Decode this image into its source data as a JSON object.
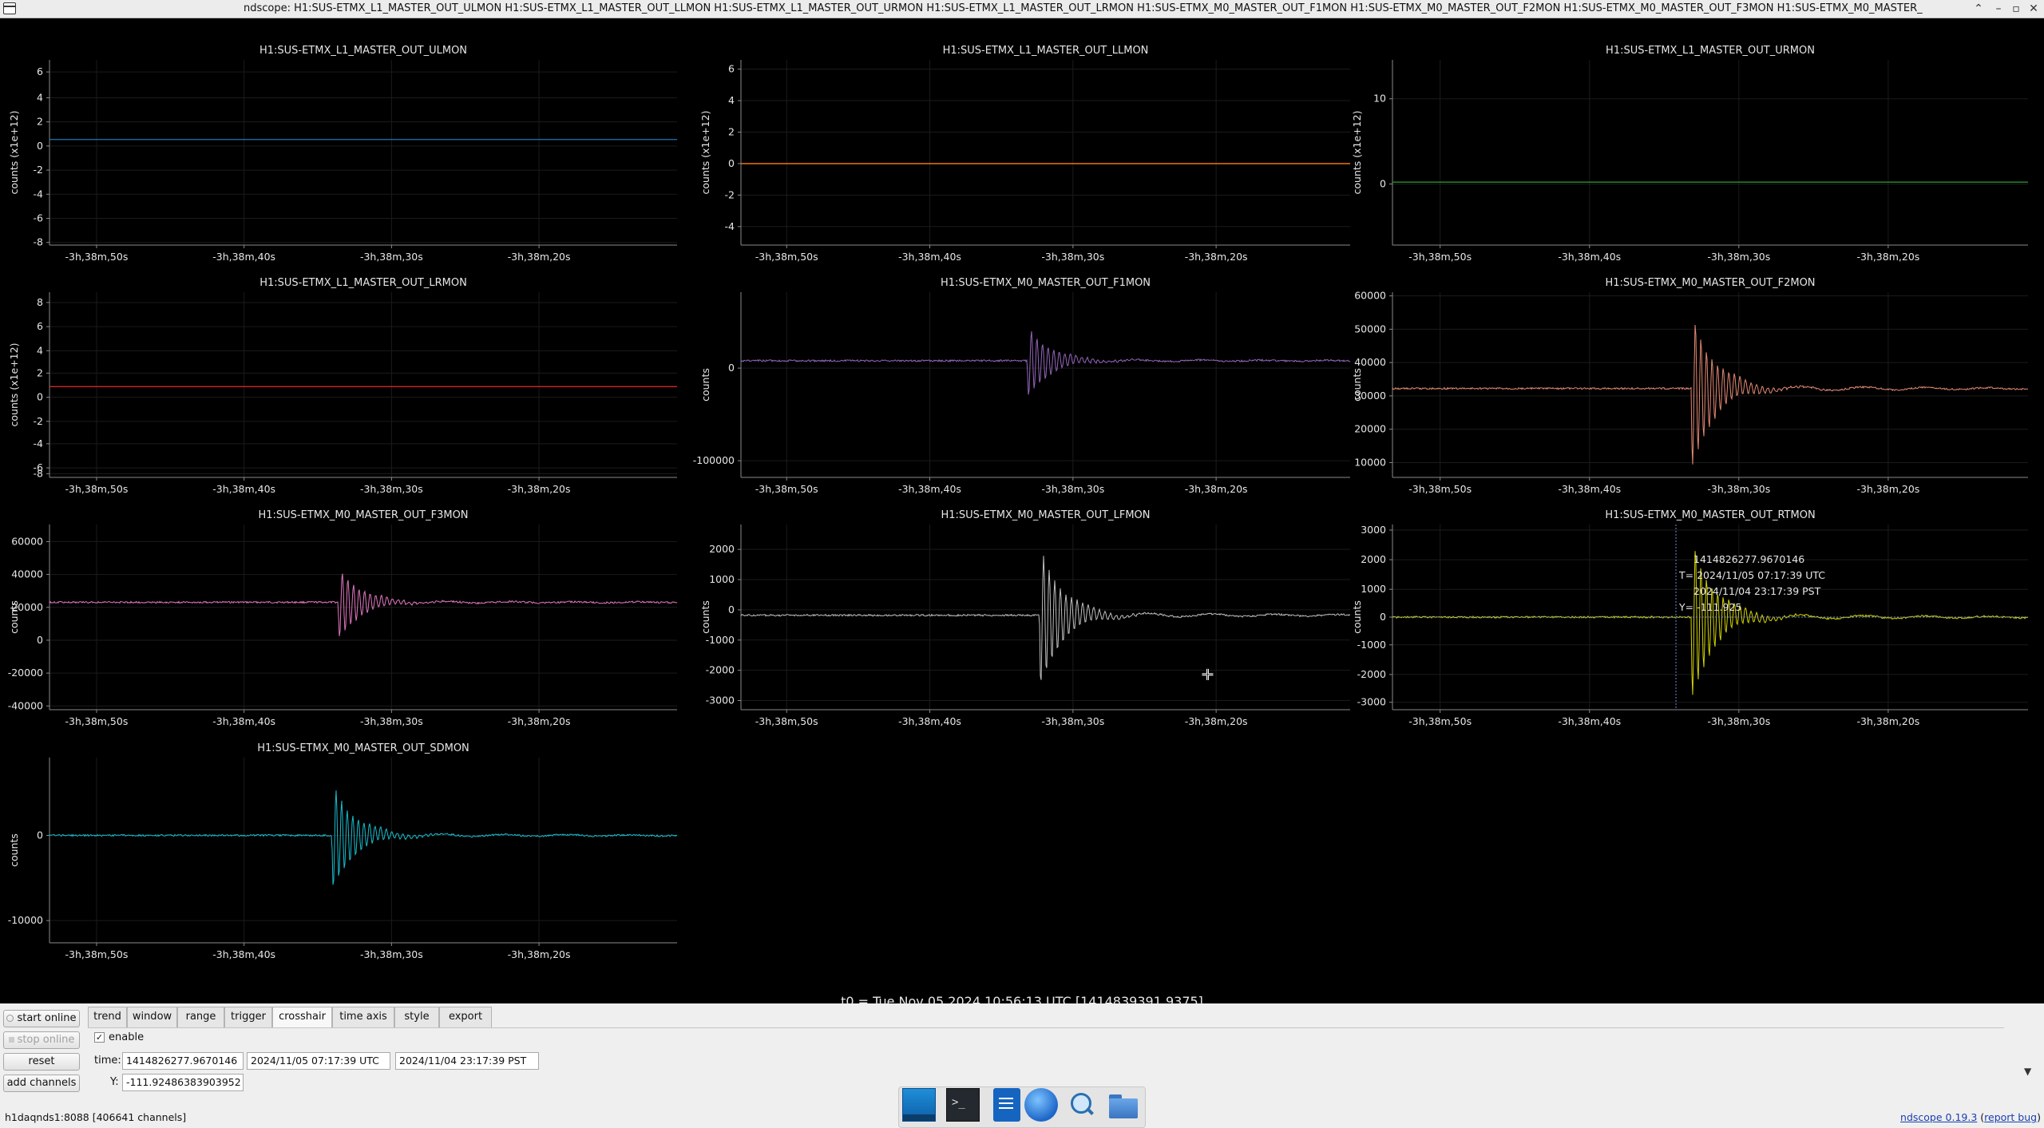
{
  "window": {
    "title": "ndscope: H1:SUS-ETMX_L1_MASTER_OUT_ULMON H1:SUS-ETMX_L1_MASTER_OUT_LLMON H1:SUS-ETMX_L1_MASTER_OUT_URMON H1:SUS-ETMX_L1_MASTER_OUT_LRMON H1:SUS-ETMX_M0_MASTER_OUT_F1MON H1:SUS-ETMX_M0_MASTER_OUT_F2MON H1:SUS-ETMX_M0_MASTER_OUT_F3MON H1:SUS-ETMX_M0_MASTER_",
    "buttons": [
      "⌃",
      "–",
      "▫",
      "✕"
    ]
  },
  "plots": [
    {
      "title": "H1:SUS-ETMX_L1_MASTER_OUT_ULMON",
      "ylabel": "counts (x1e+12)",
      "yticks": [
        "6",
        "4",
        "2",
        "0",
        "-2",
        "-4",
        "-6",
        "-8"
      ],
      "color": "#1f77b4",
      "signal": "flat",
      "level": "0"
    },
    {
      "title": "H1:SUS-ETMX_L1_MASTER_OUT_LLMON",
      "ylabel": "counts (x1e+12)",
      "yticks": [
        "6",
        "4",
        "2",
        "0",
        "-2",
        "-4"
      ],
      "color": "#ff7f0e",
      "signal": "flat",
      "level": "0"
    },
    {
      "title": "H1:SUS-ETMX_L1_MASTER_OUT_URMON",
      "ylabel": "counts (x1e+12)",
      "yticks": [
        "10",
        "0"
      ],
      "color": "#2ca02c",
      "signal": "flat",
      "level": "0"
    },
    {
      "title": "H1:SUS-ETMX_L1_MASTER_OUT_LRMON",
      "ylabel": "counts (x1e+12)",
      "yticks": [
        "8",
        "6",
        "4",
        "2",
        "0",
        "-2",
        "-4",
        "-6",
        "-8"
      ],
      "color": "#d62728",
      "signal": "flat",
      "level": "0"
    },
    {
      "title": "H1:SUS-ETMX_M0_MASTER_OUT_F1MON",
      "ylabel": "counts",
      "yticks": [
        "0",
        "-100000"
      ],
      "color": "#9467bd",
      "signal": "burst",
      "level": "0"
    },
    {
      "title": "H1:SUS-ETMX_M0_MASTER_OUT_F2MON",
      "ylabel": "counts",
      "yticks": [
        "60000",
        "50000",
        "40000",
        "30000",
        "20000",
        "10000"
      ],
      "color": "#e58a74",
      "signal": "burst",
      "level": "30000"
    },
    {
      "title": "H1:SUS-ETMX_M0_MASTER_OUT_F3MON",
      "ylabel": "counts",
      "yticks": [
        "60000",
        "40000",
        "20000",
        "0",
        "-20000",
        "-40000"
      ],
      "color": "#e377c2",
      "signal": "burst",
      "level": "23000"
    },
    {
      "title": "H1:SUS-ETMX_M0_MASTER_OUT_LFMON",
      "ylabel": "counts",
      "yticks": [
        "2000",
        "1000",
        "0",
        "-1000",
        "-2000",
        "-3000"
      ],
      "color": "#bfbfbf",
      "signal": "burst",
      "level": "0"
    },
    {
      "title": "H1:SUS-ETMX_M0_MASTER_OUT_RTMON",
      "ylabel": "counts",
      "yticks": [
        "3000",
        "2000",
        "1000",
        "0",
        "-1000",
        "-2000",
        "-3000"
      ],
      "color": "#d4d400",
      "signal": "burst",
      "level": "0"
    },
    {
      "title": "H1:SUS-ETMX_M0_MASTER_OUT_SDMON",
      "ylabel": "counts",
      "yticks": [
        "0",
        "-10000"
      ],
      "color": "#17becf",
      "signal": "burst",
      "level": "0"
    }
  ],
  "xticks": [
    "-3h,38m,50s",
    "-3h,38m,40s",
    "-3h,38m,30s",
    "-3h,38m,20s"
  ],
  "crosshair_readout": {
    "gps": "1414826277.9670146",
    "utc": "T= 2024/11/05 07:17:39 UTC",
    "local": "2024/11/04 23:17:39 PST",
    "y": "Y= -111.925"
  },
  "t0_label": "t0 = Tue Nov 05 2024 10:56:13 UTC [1414839391.9375]",
  "controls": {
    "start_online": "start online",
    "stop_online": "stop online",
    "reset": "reset",
    "add_channels": "add channels"
  },
  "tabs": [
    "trend",
    "window",
    "range",
    "trigger",
    "crosshair",
    "time axis",
    "style",
    "export"
  ],
  "active_tab": "crosshair",
  "crosshair_tab": {
    "enable_label": "enable",
    "enable_checked": true,
    "time_label": "time:",
    "time_gps": "1414826277.9670146",
    "time_utc": "2024/11/05 07:17:39 UTC",
    "time_local": "2024/11/04 23:17:39 PST",
    "y_label": "Y:",
    "y_value": "-111.92486383903952"
  },
  "status": {
    "server": "h1daqnds1:8088  [406641 channels]",
    "version_link": "ndscope 0.19.3",
    "report_prefix": " (",
    "report_link": "report bug",
    "report_suffix": ")"
  },
  "taskbar_icons": [
    "desktop-icon",
    "terminal-icon",
    "text-editor-icon",
    "browser-icon",
    "search-icon",
    "folder-icon"
  ]
}
